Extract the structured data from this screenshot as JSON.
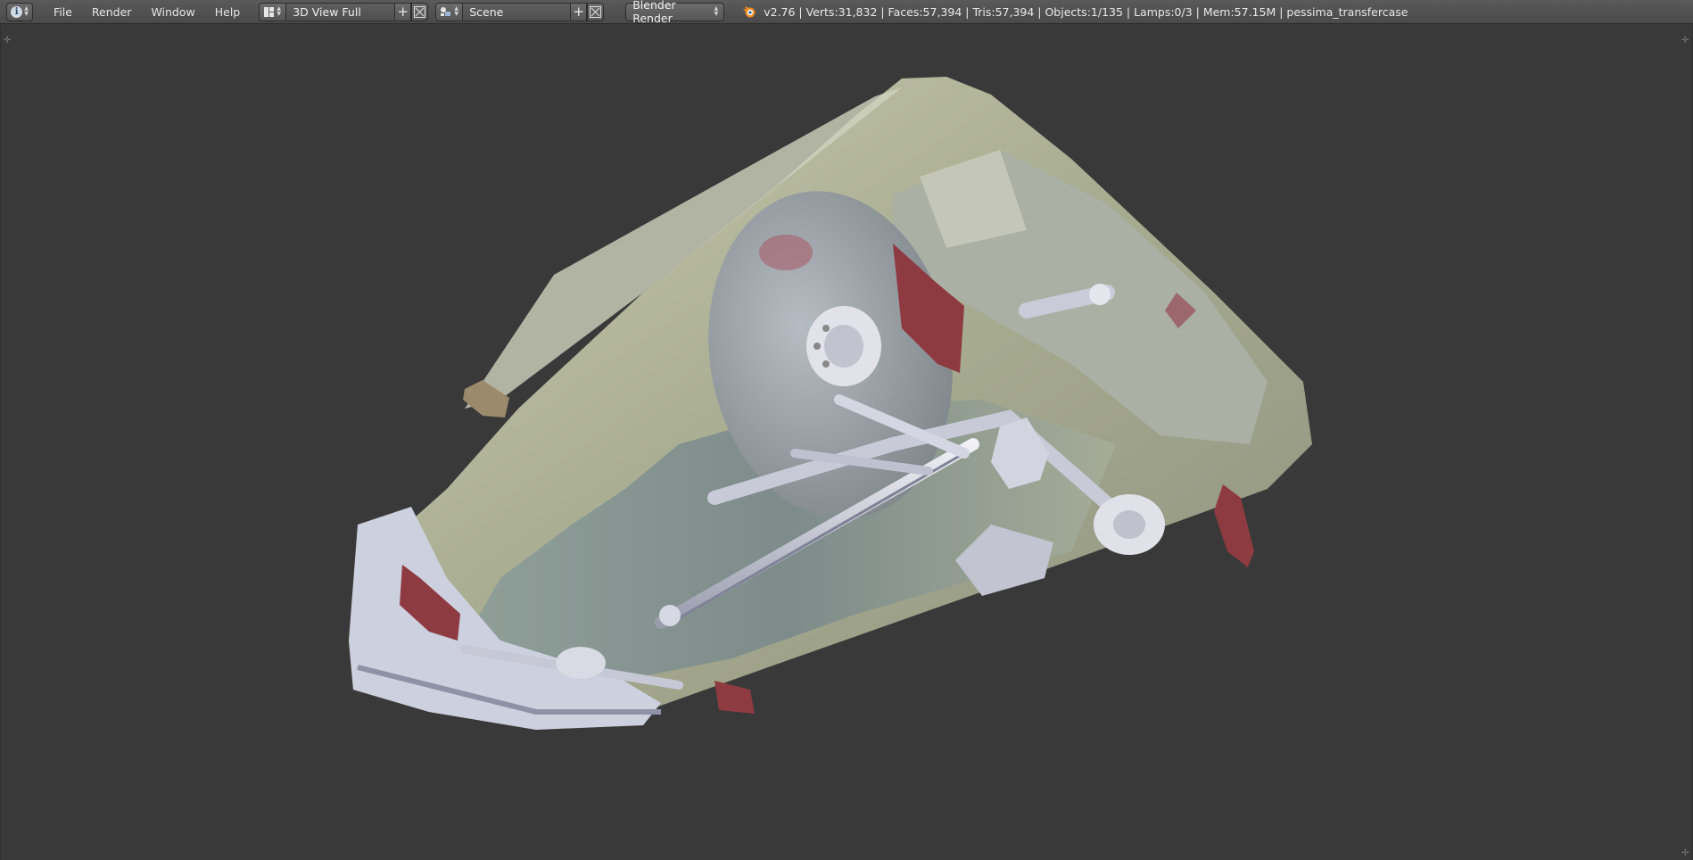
{
  "header": {
    "editor_type_icon": "info-icon",
    "menus": [
      {
        "label": "File"
      },
      {
        "label": "Render"
      },
      {
        "label": "Window"
      },
      {
        "label": "Help"
      }
    ],
    "screen_layout": {
      "icon": "screen-layout-icon",
      "name": "3D View Full"
    },
    "scene": {
      "icon": "scene-icon",
      "name": "Scene"
    },
    "render_engine": "Blender Render",
    "stats": "v2.76 | Verts:31,832 | Faces:57,394 | Tris:57,394 | Objects:1/135 | Lamps:0/3 | Mem:57.15M | pessima_transfercase"
  },
  "viewport": {
    "content": "car-underside-3d-model",
    "colors": {
      "background": "#393939",
      "body": "#b9bca3",
      "metal": "#c6c8d4",
      "mudflap": "#8e3a41"
    }
  }
}
